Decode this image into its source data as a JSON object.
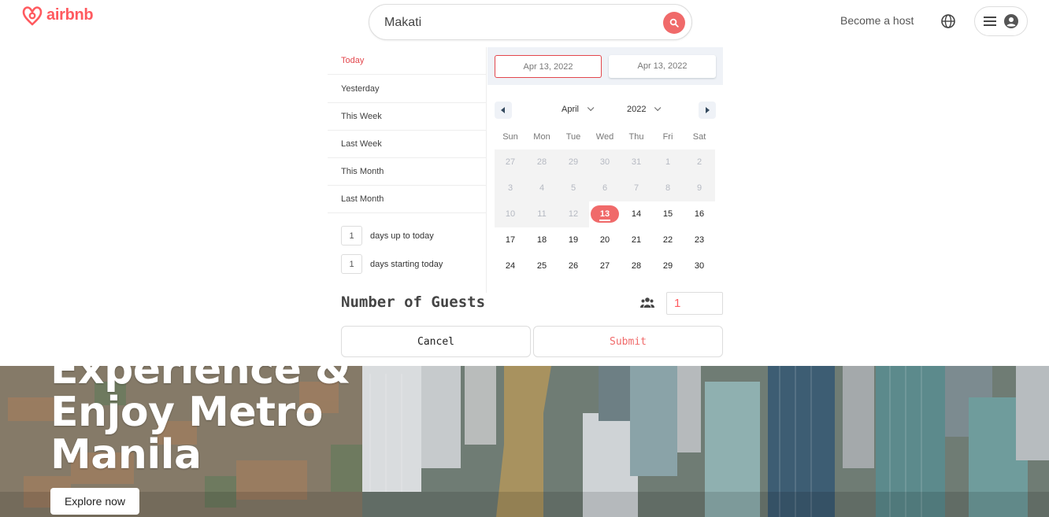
{
  "brand": {
    "name": "airbnb",
    "color": "#ff5a5f",
    "icon": "airbnb-logo-icon"
  },
  "search": {
    "value": "Makati",
    "icon": "search-icon"
  },
  "header": {
    "host_label": "Become a host",
    "globe_icon": "globe-icon",
    "menu_icon": "hamburger-menu-icon",
    "user_icon": "user-avatar-icon"
  },
  "date_ranges": {
    "items": [
      {
        "label": "Today",
        "active": true
      },
      {
        "label": "Yesterday",
        "active": false
      },
      {
        "label": "This Week",
        "active": false
      },
      {
        "label": "Last Week",
        "active": false
      },
      {
        "label": "This Month",
        "active": false
      },
      {
        "label": "Last Month",
        "active": false
      }
    ],
    "inputs": [
      {
        "value": "1",
        "label": "days up to today"
      },
      {
        "value": "1",
        "label": "days starting today"
      }
    ]
  },
  "calendar": {
    "start_date": "Apr 13, 2022",
    "end_date": "Apr 13, 2022",
    "month": "April",
    "year": "2022",
    "weekdays": [
      "Sun",
      "Mon",
      "Tue",
      "Wed",
      "Thu",
      "Fri",
      "Sat"
    ],
    "days": [
      {
        "d": "27",
        "passive": true
      },
      {
        "d": "28",
        "passive": true
      },
      {
        "d": "29",
        "passive": true
      },
      {
        "d": "30",
        "passive": true
      },
      {
        "d": "31",
        "passive": true
      },
      {
        "d": "1",
        "passive": true
      },
      {
        "d": "2",
        "passive": true
      },
      {
        "d": "3",
        "passive": true
      },
      {
        "d": "4",
        "passive": true
      },
      {
        "d": "5",
        "passive": true
      },
      {
        "d": "6",
        "passive": true
      },
      {
        "d": "7",
        "passive": true
      },
      {
        "d": "8",
        "passive": true
      },
      {
        "d": "9",
        "passive": true
      },
      {
        "d": "10",
        "passive": true
      },
      {
        "d": "11",
        "passive": true
      },
      {
        "d": "12",
        "passive": true
      },
      {
        "d": "13",
        "selected": true
      },
      {
        "d": "14"
      },
      {
        "d": "15"
      },
      {
        "d": "16"
      },
      {
        "d": "17"
      },
      {
        "d": "18"
      },
      {
        "d": "19"
      },
      {
        "d": "20"
      },
      {
        "d": "21"
      },
      {
        "d": "22"
      },
      {
        "d": "23"
      },
      {
        "d": "24"
      },
      {
        "d": "25"
      },
      {
        "d": "26"
      },
      {
        "d": "27"
      },
      {
        "d": "28"
      },
      {
        "d": "29"
      },
      {
        "d": "30"
      }
    ],
    "accent": "#f06a6a"
  },
  "guests": {
    "label": "Number of Guests",
    "value": "1",
    "icon": "users-icon"
  },
  "actions": {
    "cancel": "Cancel",
    "submit": "Submit"
  },
  "hero": {
    "lines": [
      "Experience &",
      "Enjoy Metro",
      "Manila"
    ],
    "cta": "Explore now"
  }
}
